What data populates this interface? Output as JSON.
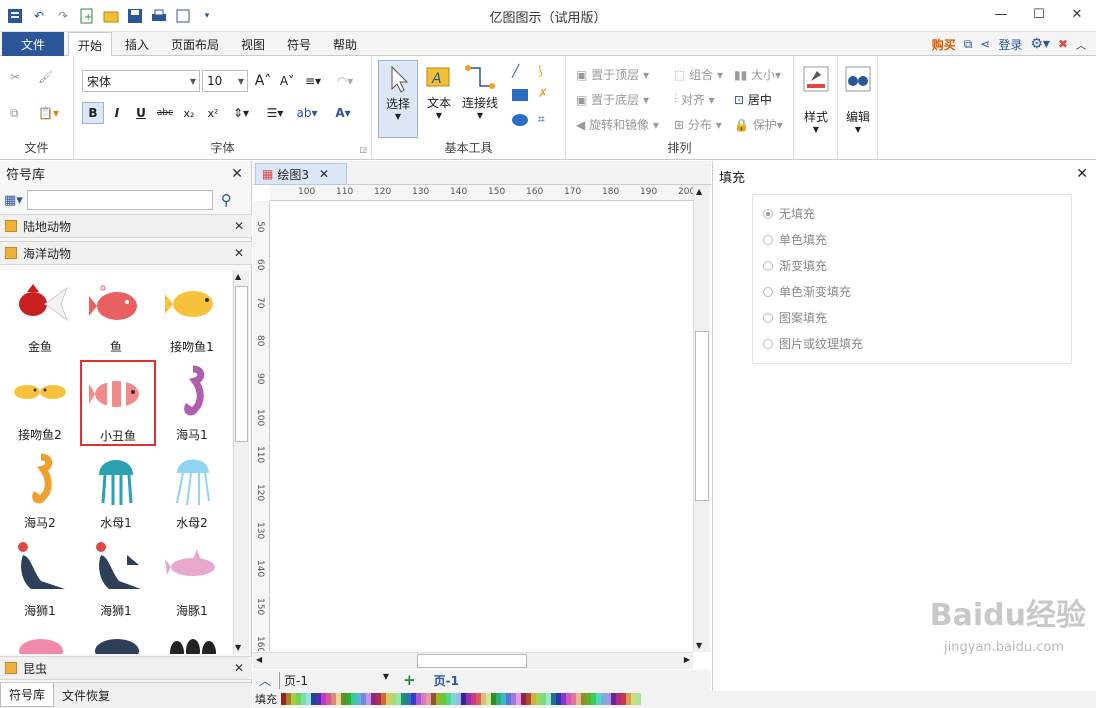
{
  "app": {
    "title": "亿图图示（试用版）"
  },
  "window": {
    "minimize": "—",
    "maximize": "☐",
    "close": "✕"
  },
  "qat": {
    "icons": [
      "app-icon",
      "undo-icon",
      "redo-icon",
      "new-icon",
      "open-icon",
      "save-icon",
      "print-icon",
      "export-icon"
    ]
  },
  "tabs": [
    {
      "label": "文件"
    },
    {
      "label": "开始"
    },
    {
      "label": "插入"
    },
    {
      "label": "页面布局"
    },
    {
      "label": "视图"
    },
    {
      "label": "符号"
    },
    {
      "label": "帮助"
    }
  ],
  "rightnav": {
    "buy": "购买",
    "login": "登录"
  },
  "ribbon": {
    "groups": {
      "file": "文件",
      "font": "字体",
      "basic_tools": "基本工具",
      "arrange": "排列"
    },
    "font_name": "宋体",
    "font_size": "10",
    "select": "选择",
    "text": "文本",
    "connector": "连接线",
    "bring_front": "置于顶层",
    "send_back": "置于底层",
    "rotate_mirror": "旋转和镜像",
    "group": "组合",
    "align": "对齐",
    "distribute": "分布",
    "size": "大小",
    "center": "居中",
    "protect": "保护",
    "style": "样式",
    "edit": "编辑"
  },
  "library": {
    "title": "符号库",
    "search_placeholder": "",
    "categories": [
      {
        "name": "陆地动物"
      },
      {
        "name": "海洋动物"
      },
      {
        "name": "昆虫"
      }
    ],
    "symbols": [
      {
        "label": "金鱼"
      },
      {
        "label": "鱼"
      },
      {
        "label": "接吻鱼1"
      },
      {
        "label": "接吻鱼2"
      },
      {
        "label": "小丑鱼"
      },
      {
        "label": "海马1"
      },
      {
        "label": "海马2"
      },
      {
        "label": "水母1"
      },
      {
        "label": "水母2"
      },
      {
        "label": "海狮1"
      },
      {
        "label": "海狮1"
      },
      {
        "label": "海豚1"
      }
    ],
    "selected": "小丑鱼",
    "bottom_tabs": [
      {
        "label": "符号库"
      },
      {
        "label": "文件恢复"
      }
    ]
  },
  "document": {
    "tab": "绘图3",
    "hruler": [
      "100",
      "110",
      "120",
      "130",
      "140",
      "150",
      "160",
      "170",
      "180",
      "190",
      "200"
    ],
    "vruler": [
      "50",
      "60",
      "70",
      "80",
      "90",
      "100",
      "110",
      "120",
      "130",
      "140",
      "150",
      "160"
    ],
    "page_select": "页-1",
    "page_tab": "页-1",
    "fill_label": "填充"
  },
  "fill_panel": {
    "title": "填充",
    "options": [
      {
        "label": "无填充",
        "selected": true
      },
      {
        "label": "单色填充",
        "selected": false
      },
      {
        "label": "渐变填充",
        "selected": false
      },
      {
        "label": "单色渐变填充",
        "selected": false
      },
      {
        "label": "图案填充",
        "selected": false
      },
      {
        "label": "图片或纹理填充",
        "selected": false
      }
    ]
  },
  "watermark": {
    "main": "Baidu经验",
    "sub": "jingyan.baidu.com"
  },
  "colors": {
    "accent": "#2b579a",
    "selection": "#e03030",
    "buy": "#e05a00"
  }
}
